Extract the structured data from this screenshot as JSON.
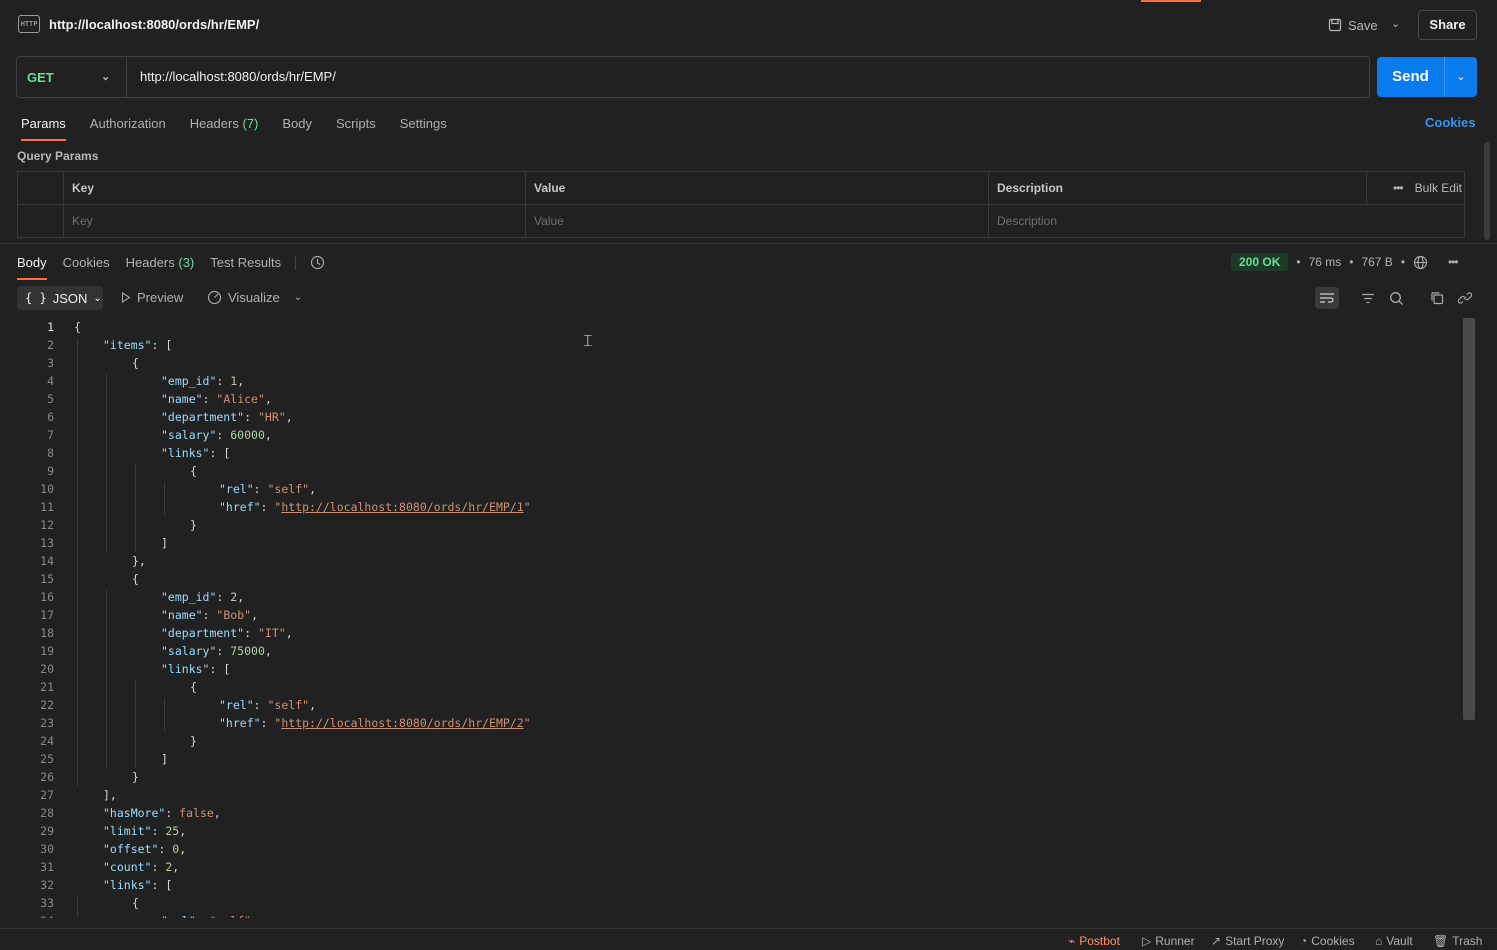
{
  "header": {
    "http_icon": "http-icon",
    "title": "http://localhost:8080/ords/hr/EMP/",
    "save_label": "Save",
    "share_label": "Share"
  },
  "request": {
    "method": "GET",
    "method_color": "#6bdd9a",
    "url": "http://localhost:8080/ords/hr/EMP/",
    "send_label": "Send",
    "send_color": "#097bed"
  },
  "req_tabs": [
    {
      "label": "Params"
    },
    {
      "label": "Authorization"
    },
    {
      "label": "Headers",
      "count": "(7)"
    },
    {
      "label": "Body"
    },
    {
      "label": "Scripts"
    },
    {
      "label": "Settings"
    }
  ],
  "cookies_link": "Cookies",
  "query_params": {
    "title": "Query Params",
    "headers": [
      "Key",
      "Value",
      "Description"
    ],
    "placeholders": [
      "Key",
      "Value",
      "Description"
    ],
    "bulk_edit": "Bulk Edit"
  },
  "resp_tabs": [
    {
      "label": "Body"
    },
    {
      "label": "Cookies"
    },
    {
      "label": "Headers",
      "count": "(3)"
    },
    {
      "label": "Test Results"
    }
  ],
  "status": {
    "code": "200 OK",
    "time": "76 ms",
    "size": "767 B"
  },
  "viewer": {
    "format": "JSON",
    "preview": "Preview",
    "visualize": "Visualize"
  },
  "code_lines": [
    "{",
    "\"items\": [",
    "{",
    "\"emp_id\": 1,",
    "\"name\": \"Alice\",",
    "\"department\": \"HR\",",
    "\"salary\": 60000,",
    "\"links\": [",
    "{",
    "\"rel\": \"self\",",
    "\"href\": \"http://localhost:8080/ords/hr/EMP/1\"",
    "}",
    "]",
    "},",
    "{",
    "\"emp_id\": 2,",
    "\"name\": \"Bob\",",
    "\"department\": \"IT\",",
    "\"salary\": 75000,",
    "\"links\": [",
    "{",
    "\"rel\": \"self\",",
    "\"href\": \"http://localhost:8080/ords/hr/EMP/2\"",
    "}",
    "]",
    "}",
    "],",
    "\"hasMore\": false,",
    "\"limit\": 25,",
    "\"offset\": 0,",
    "\"count\": 2,",
    "\"links\": [",
    "{",
    "\"rel\": \"self\""
  ],
  "footer": {
    "items": [
      "Postbot",
      "Runner",
      "Start Proxy",
      "Cookies",
      "Vault",
      "Trash"
    ]
  }
}
